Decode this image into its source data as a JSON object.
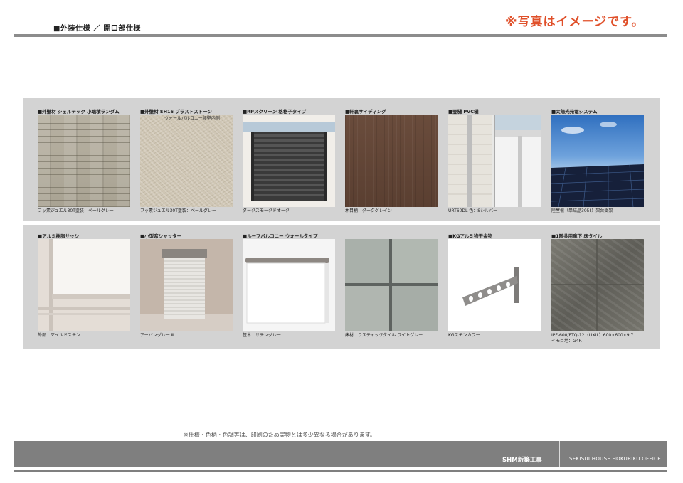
{
  "header": {
    "title": "■外装仕様 ／ 開口部仕様",
    "notice": "※写真はイメージです。"
  },
  "rows": [
    {
      "items": [
        {
          "label": "■外壁材 シェルテック 小端積ランダム",
          "caption": "フッ素ジュエル30T塗装：ペールグレー",
          "swatch": "stone-wall-icon"
        },
        {
          "label": "■外壁材 SH16 ブラストストーン",
          "sublabel": "ウォールバルコニー腰壁内側",
          "caption": "フッ素ジュエル30T塗装：ペールグレー",
          "swatch": "blast-stone-icon"
        },
        {
          "label": "■RPスクリーン 格格子タイプ",
          "caption": "ダークスモークドオーク",
          "swatch": "rp-screen-icon"
        },
        {
          "label": "■軒裏サイディング",
          "caption": "木目柄：ダークグレイン",
          "swatch": "wood-siding-icon"
        },
        {
          "label": "■竪樋 PVC樋",
          "caption": "URT60DL 色：Sシルバー",
          "swatch": "gutter-icon"
        },
        {
          "label": "■太陽光発電システム",
          "caption": "陸屋根（単結晶305Ⅱ）架台受架",
          "swatch": "solar-panel-icon"
        }
      ]
    },
    {
      "items": [
        {
          "label": "■アルミ樹脂サッシ",
          "caption": "外部：マイルドステン",
          "swatch": "window-sash-icon"
        },
        {
          "label": "■小型窓シャッター",
          "caption": "アーバングレー Ⅲ",
          "swatch": "window-shutter-icon"
        },
        {
          "label": "■ルーフバルコニー ウォールタイプ",
          "caption": "笠木：サテングレー",
          "swatch": "roof-balcony-icon"
        },
        {
          "label": "",
          "caption": "床材：ラスティックタイル ライトグレー",
          "swatch": "rustic-tile-icon"
        },
        {
          "label": "■KGアルミ物干金物",
          "caption": "KGステンカラー",
          "swatch": "laundry-hanger-icon"
        },
        {
          "label": "■1階共用廊下 床タイル",
          "caption": "IPF-600/PTQ-12（LIXIL）600×600×9.7",
          "caption2": "イモ目地：G4R",
          "swatch": "floor-tile-icon"
        }
      ]
    }
  ],
  "footer": {
    "note": "※仕様・色柄・色調等は、印刷のため実物とは多少異なる場合があります。",
    "project": "SHM新築工事",
    "company": "SEKISUI HOUSE HOKURIKU OFFICE"
  }
}
